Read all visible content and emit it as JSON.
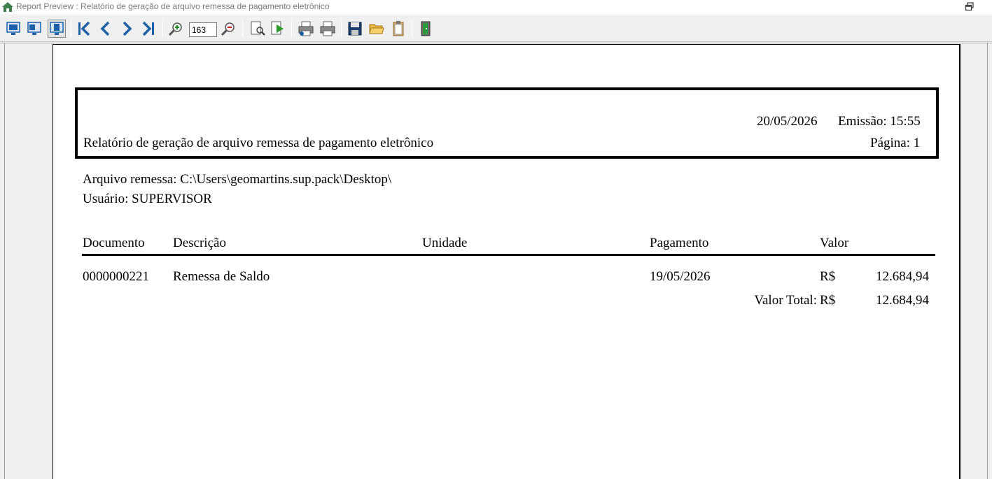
{
  "window": {
    "title": "Report Preview : Relatório de geração de arquivo remessa de pagamento eletrônico"
  },
  "toolbar": {
    "zoom_value": "163",
    "buttons": [
      {
        "name": "whole-page-button",
        "icon": "monitor-icon"
      },
      {
        "name": "page-width-button",
        "icon": "monitor-icon"
      },
      {
        "name": "actual-size-button",
        "icon": "monitor-icon"
      },
      {
        "name": "first-page-button",
        "icon": "first-page-icon"
      },
      {
        "name": "previous-page-button",
        "icon": "chevron-left-icon"
      },
      {
        "name": "next-page-button",
        "icon": "chevron-right-icon"
      },
      {
        "name": "last-page-button",
        "icon": "last-page-icon"
      },
      {
        "name": "zoom-in-button",
        "icon": "zoom-in-icon"
      },
      {
        "name": "zoom-out-button",
        "icon": "zoom-out-icon"
      },
      {
        "name": "find-button",
        "icon": "find-icon"
      },
      {
        "name": "find-next-button",
        "icon": "find-next-icon"
      },
      {
        "name": "print-setup-button",
        "icon": "printer-icon"
      },
      {
        "name": "print-button",
        "icon": "printer-icon"
      },
      {
        "name": "save-button",
        "icon": "floppy-icon"
      },
      {
        "name": "open-button",
        "icon": "folder-icon"
      },
      {
        "name": "copy-button",
        "icon": "clipboard-icon"
      },
      {
        "name": "exit-button",
        "icon": "exit-door-icon"
      }
    ]
  },
  "report": {
    "header": {
      "date": "20/05/2026",
      "emission": "Emissão: 15:55",
      "title": "Relatório de geração de arquivo remessa de pagamento eletrônico",
      "page": "Página: 1"
    },
    "file_line": "Arquivo remessa: C:\\Users\\geomartins.sup.pack\\Desktop\\",
    "user_line": "Usuário: SUPERVISOR",
    "columns": {
      "documento": "Documento",
      "descricao": "Descrição",
      "unidade": "Unidade",
      "pagamento": "Pagamento",
      "valor": "Valor"
    },
    "rows": [
      {
        "documento": "0000000221",
        "descricao": "Remessa de Saldo",
        "unidade": "",
        "pagamento": "19/05/2026",
        "currency": "R$",
        "valor": "12.684,94"
      }
    ],
    "total": {
      "label": "Valor Total:",
      "currency": "R$",
      "valor": "12.684,94"
    }
  },
  "colors": {
    "title_text": "#7a7a7a",
    "toolbar_bg": "#f0f0f0",
    "icon_blue": "#1f5fa8",
    "app_icon_green": "#3e7f4e"
  }
}
